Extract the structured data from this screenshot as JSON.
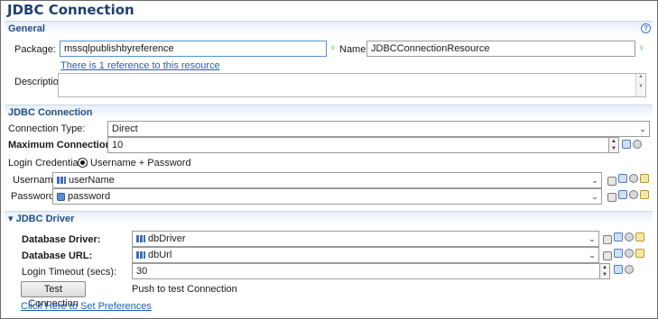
{
  "header": {
    "title": "JDBC Connection",
    "help": "?"
  },
  "general": {
    "section_title": "General",
    "package_label": "Package:",
    "package_value": "mssqlpublishbyreference",
    "name_label": "Name:",
    "name_value": "JDBCConnectionResource",
    "reference_link": "There is 1 reference to this resource",
    "description_label": "Description:"
  },
  "jdbc_connection": {
    "section_title": "JDBC Connection",
    "type_label": "Connection Type:",
    "type_value": "Direct",
    "max_label": "Maximum Connections:",
    "max_value": "10",
    "credentials_label": "Login Credentials:",
    "credentials_option": "Username + Password",
    "username_label": "Username:",
    "username_value": "userName",
    "password_label": "Password:",
    "password_value": "password"
  },
  "jdbc_driver": {
    "section_title": "JDBC Driver",
    "collapse_glyph": "▾",
    "driver_label": "Database Driver:",
    "driver_value": "dbDriver",
    "url_label": "Database URL:",
    "url_value": "dbUrl",
    "timeout_label": "Login Timeout (secs):",
    "timeout_value": "30",
    "test_button": "Test Connection",
    "test_hint": "Push to test Connection",
    "prefs_link": "Click Here to Set Preferences"
  },
  "icons": {
    "dropdown": "⌄",
    "spin_up": "▲",
    "spin_down": "▼",
    "bulb": "♀"
  }
}
